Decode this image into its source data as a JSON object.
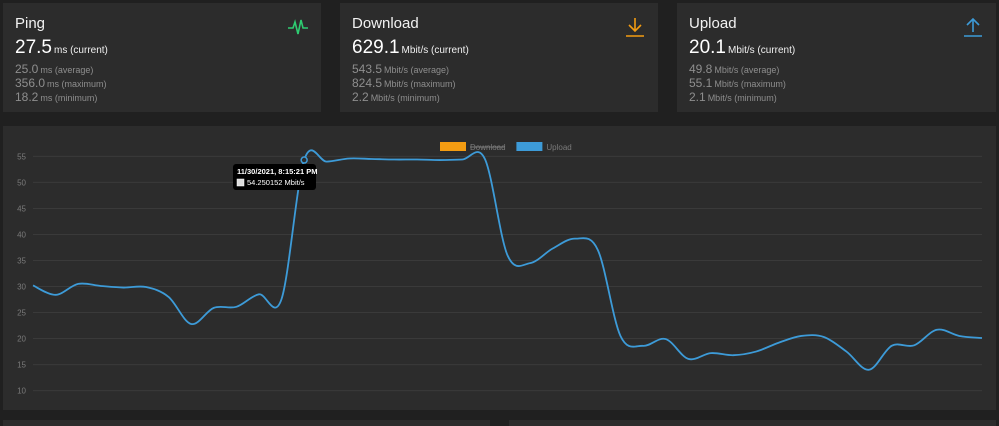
{
  "cards": [
    {
      "title": "Ping",
      "icon": "activity-pulse-icon",
      "icon_color": "#2ecc71",
      "current": {
        "value": "27.5",
        "unit": "ms (current)"
      },
      "average": {
        "value": "25.0",
        "unit": "ms (average)"
      },
      "maximum": {
        "value": "356.0",
        "unit": "ms (maximum)"
      },
      "minimum": {
        "value": "18.2",
        "unit": "ms (minimum)"
      }
    },
    {
      "title": "Download",
      "icon": "download-arrow-icon",
      "icon_color": "#f39c12",
      "current": {
        "value": "629.1",
        "unit": "Mbit/s (current)"
      },
      "average": {
        "value": "543.5",
        "unit": "Mbit/s (average)"
      },
      "maximum": {
        "value": "824.5",
        "unit": "Mbit/s (maximum)"
      },
      "minimum": {
        "value": "2.2",
        "unit": "Mbit/s (minimum)"
      }
    },
    {
      "title": "Upload",
      "icon": "upload-arrow-icon",
      "icon_color": "#3d9bd8",
      "current": {
        "value": "20.1",
        "unit": "Mbit/s (current)"
      },
      "average": {
        "value": "49.8",
        "unit": "Mbit/s (average)"
      },
      "maximum": {
        "value": "55.1",
        "unit": "Mbit/s (maximum)"
      },
      "minimum": {
        "value": "2.1",
        "unit": "Mbit/s (minimum)"
      }
    }
  ],
  "chart_data": {
    "type": "line",
    "ylim": [
      8,
      57
    ],
    "y_ticks": [
      10,
      15,
      20,
      25,
      30,
      35,
      40,
      45,
      50,
      55
    ],
    "grid": true,
    "legend_position": "top-center",
    "legend": [
      {
        "name": "Download",
        "color": "#f39c12",
        "hidden": true
      },
      {
        "name": "Upload",
        "color": "#3d9bd8",
        "hidden": false
      }
    ],
    "series": [
      {
        "name": "Upload",
        "color": "#3d9bd8",
        "values": [
          30.2,
          28.4,
          30.5,
          30.1,
          29.8,
          29.9,
          28.0,
          22.8,
          25.9,
          26.1,
          28.5,
          27.6,
          54.3,
          54.0,
          54.6,
          54.5,
          54.4,
          54.4,
          54.3,
          54.4,
          54.5,
          36.0,
          34.5,
          37.3,
          39.2,
          37.0,
          20.5,
          18.6,
          19.9,
          16.1,
          17.2,
          16.8,
          17.5,
          19.2,
          20.5,
          20.3,
          17.5,
          14.0,
          18.6,
          18.7,
          21.7,
          20.5,
          20.1
        ]
      }
    ],
    "tooltip": {
      "title": "11/30/2021, 8:15:21 PM",
      "value": "54.250152 Mbit/s",
      "point_index": 12
    }
  }
}
